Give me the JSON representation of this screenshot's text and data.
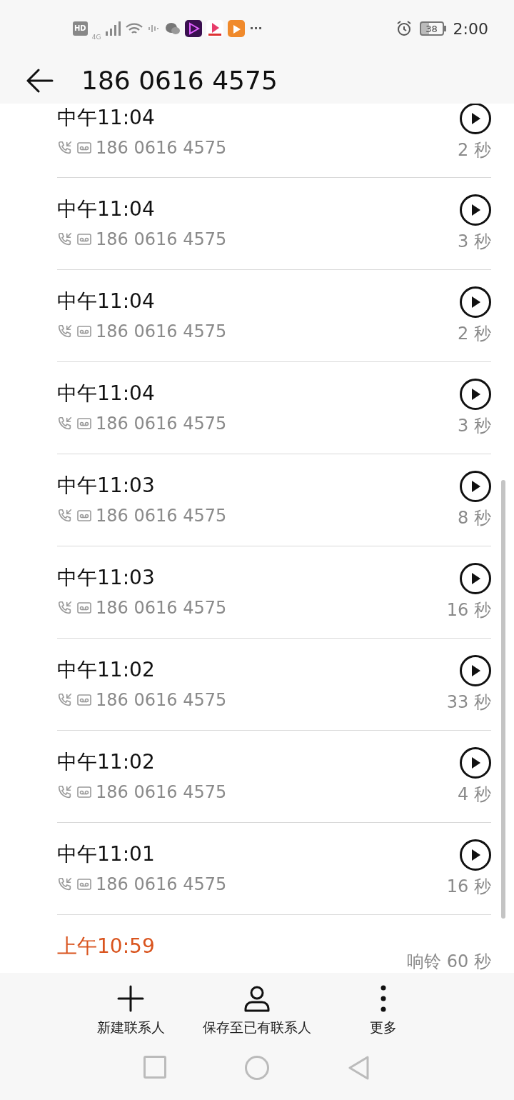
{
  "status_bar": {
    "hd": "HD",
    "network": "4G",
    "more": "···",
    "battery": "38",
    "time": "2:00"
  },
  "header": {
    "title": "186 0616 4575"
  },
  "calls": [
    {
      "kind": "voicemail",
      "time": "中午11:04",
      "number": "186 0616 4575",
      "duration": "2 秒"
    },
    {
      "kind": "voicemail",
      "time": "中午11:04",
      "number": "186 0616 4575",
      "duration": "3 秒"
    },
    {
      "kind": "voicemail",
      "time": "中午11:04",
      "number": "186 0616 4575",
      "duration": "2 秒"
    },
    {
      "kind": "voicemail",
      "time": "中午11:04",
      "number": "186 0616 4575",
      "duration": "3 秒"
    },
    {
      "kind": "voicemail",
      "time": "中午11:03",
      "number": "186 0616 4575",
      "duration": "8 秒"
    },
    {
      "kind": "voicemail",
      "time": "中午11:03",
      "number": "186 0616 4575",
      "duration": "16 秒"
    },
    {
      "kind": "voicemail",
      "time": "中午11:02",
      "number": "186 0616 4575",
      "duration": "33 秒"
    },
    {
      "kind": "voicemail",
      "time": "中午11:02",
      "number": "186 0616 4575",
      "duration": "4 秒"
    },
    {
      "kind": "voicemail",
      "time": "中午11:01",
      "number": "186 0616 4575",
      "duration": "16 秒"
    },
    {
      "kind": "missed",
      "time": "上午10:59",
      "duration": "响铃 60 秒"
    }
  ],
  "actions": [
    {
      "kind": "plus",
      "label": "新建联系人"
    },
    {
      "kind": "person",
      "label": "保存至已有联系人"
    },
    {
      "kind": "more",
      "label": "更多"
    }
  ]
}
